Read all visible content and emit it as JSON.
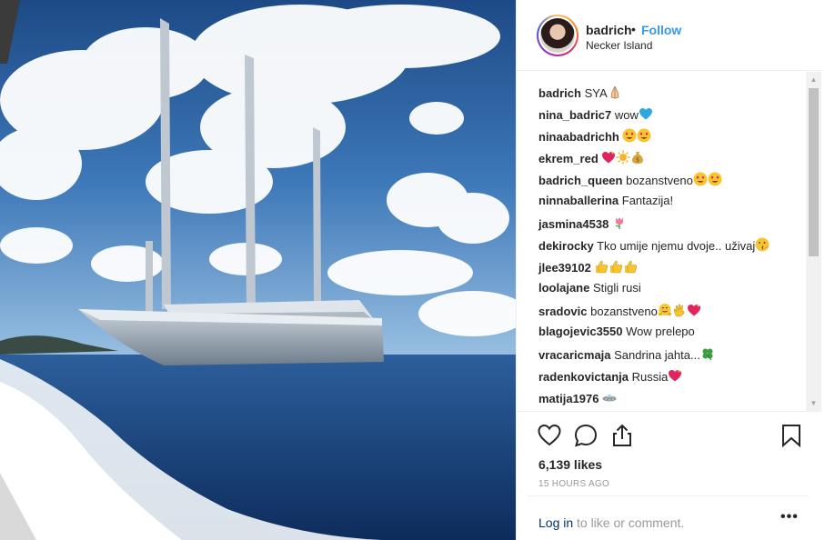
{
  "header": {
    "username": "badrich",
    "dot": "•",
    "follow_label": "Follow",
    "location": "Necker Island"
  },
  "comments": [
    {
      "user": "badrich",
      "text": "SYA",
      "emoji": [
        "folded-hands-emoji"
      ]
    },
    {
      "user": "nina_badric7",
      "text": "wow",
      "emoji": [
        "blue-heart-emoji"
      ]
    },
    {
      "user": "ninaabadrichh",
      "text": "",
      "emoji": [
        "heart-eyes-emoji",
        "heart-eyes-emoji"
      ]
    },
    {
      "user": "ekrem_red",
      "text": "",
      "emoji": [
        "sparkling-heart-emoji",
        "sun-emoji",
        "money-bag-emoji"
      ]
    },
    {
      "user": "badrich_queen",
      "text": "bozanstveno",
      "emoji": [
        "heart-eyes-emoji",
        "heart-eyes-emoji"
      ]
    },
    {
      "user": "ninnaballerina",
      "text": "Fantazija!",
      "emoji": []
    },
    {
      "user": "jasmina4538",
      "text": "",
      "emoji": [
        "tulip-emoji"
      ]
    },
    {
      "user": "dekirocky",
      "text": "Tko umije njemu dvoje.. uživaj",
      "emoji": [
        "kiss-wink-emoji"
      ]
    },
    {
      "user": "jlee39102",
      "text": "",
      "emoji": [
        "thumbs-up-emoji",
        "thumbs-up-emoji",
        "thumbs-up-emoji"
      ]
    },
    {
      "user": "loolajane",
      "text": "Stigli rusi",
      "emoji": []
    },
    {
      "user": "sradovic",
      "text": "bozanstveno",
      "emoji": [
        "hug-emoji",
        "clap-emoji",
        "sparkling-heart-emoji"
      ]
    },
    {
      "user": "blagojevic3550",
      "text": "Wow prelepo",
      "emoji": []
    },
    {
      "user": "vracaricmaja",
      "text": "Sandrina jahta...",
      "emoji": [
        "four-leaf-clover-emoji"
      ]
    },
    {
      "user": "radenkovictanja",
      "text": "Russia",
      "emoji": [
        "sparkling-heart-emoji"
      ]
    },
    {
      "user": "matija1976",
      "text": "",
      "emoji": [
        "ufo-emoji"
      ]
    }
  ],
  "actions": {
    "like_icon": "heart-outline-icon",
    "comment_icon": "speech-bubble-icon",
    "share_icon": "share-upload-icon",
    "save_icon": "bookmark-icon"
  },
  "likes": "6,139 likes",
  "time": "15 HOURS AGO",
  "login": {
    "link": "Log in",
    "rest": "to like or comment.",
    "more": "•••"
  },
  "colors": {
    "accent": "#3897f0",
    "text": "#262626",
    "muted": "#999999",
    "link": "#003569"
  }
}
